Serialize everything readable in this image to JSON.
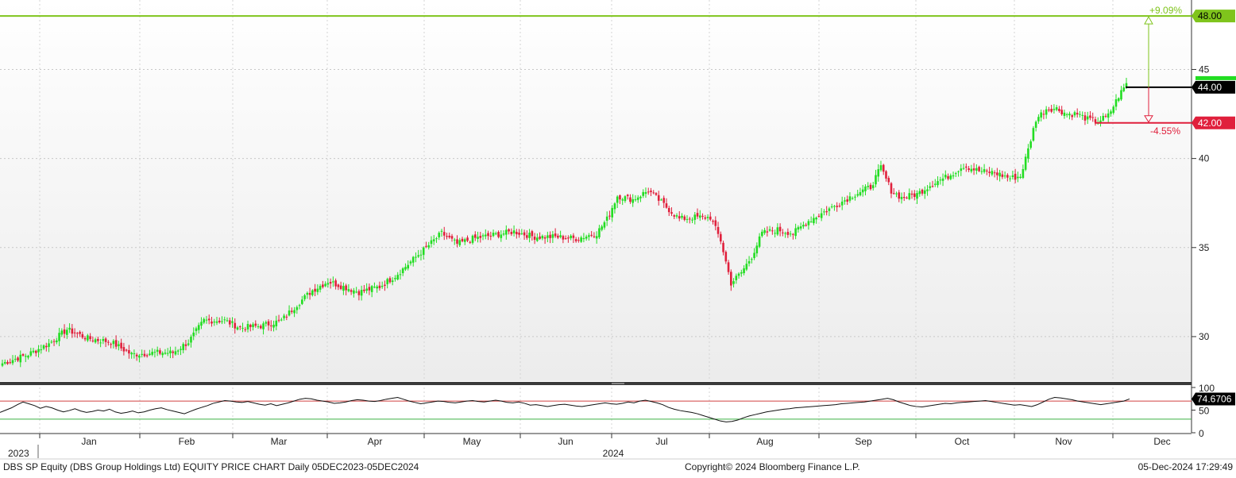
{
  "footer": {
    "title": "DBS SP Equity (DBS Group Holdings Ltd) EQUITY PRICE CHART  Daily 05DEC2023-05DEC2024",
    "copyright": "Copyright© 2024 Bloomberg Finance L.P.",
    "timestamp": "05-Dec-2024 17:29:49"
  },
  "colors": {
    "up": "#22dd22",
    "down": "#e0203c",
    "target": "#7fc41c",
    "stop": "#e0203c",
    "current": "#000000",
    "oscillator_upper": "#d04040",
    "oscillator_lower": "#3cb043"
  },
  "chart_data": [
    {
      "type": "candlestick",
      "name": "price",
      "ylim": [
        27.5,
        48.9
      ],
      "y_ticks": [
        30,
        35,
        40,
        45
      ],
      "y_tick_labels": [
        "30",
        "35",
        "40",
        "45"
      ],
      "grid": true,
      "x_year_labels": [
        "2023",
        "2024"
      ],
      "x_month_labels": [
        "Jan",
        "Feb",
        "Mar",
        "Apr",
        "May",
        "Jun",
        "Jul",
        "Aug",
        "Sep",
        "Oct",
        "Nov",
        "Dec"
      ],
      "anchors": [
        [
          0,
          28.5
        ],
        [
          10,
          29.0
        ],
        [
          18,
          29.6
        ],
        [
          25,
          30.4
        ],
        [
          33,
          29.9
        ],
        [
          42,
          29.7
        ],
        [
          50,
          29.0
        ],
        [
          60,
          29.1
        ],
        [
          66,
          29.1
        ],
        [
          72,
          29.7
        ],
        [
          78,
          30.9
        ],
        [
          86,
          30.9
        ],
        [
          92,
          30.5
        ],
        [
          100,
          30.6
        ],
        [
          108,
          30.9
        ],
        [
          114,
          31.8
        ],
        [
          120,
          32.6
        ],
        [
          126,
          33.1
        ],
        [
          132,
          32.8
        ],
        [
          138,
          32.5
        ],
        [
          146,
          32.8
        ],
        [
          152,
          33.4
        ],
        [
          158,
          34.2
        ],
        [
          164,
          35.0
        ],
        [
          170,
          35.8
        ],
        [
          176,
          35.2
        ],
        [
          182,
          35.5
        ],
        [
          190,
          35.7
        ],
        [
          198,
          35.9
        ],
        [
          206,
          35.6
        ],
        [
          214,
          35.6
        ],
        [
          222,
          35.5
        ],
        [
          230,
          35.8
        ],
        [
          234,
          36.6
        ],
        [
          238,
          37.9
        ],
        [
          244,
          37.7
        ],
        [
          250,
          38.2
        ],
        [
          256,
          37.4
        ],
        [
          262,
          36.6
        ],
        [
          268,
          36.7
        ],
        [
          274,
          36.7
        ],
        [
          278,
          35.4
        ],
        [
          282,
          33.0
        ],
        [
          286,
          33.6
        ],
        [
          290,
          34.5
        ],
        [
          294,
          35.8
        ],
        [
          300,
          36.0
        ],
        [
          306,
          35.8
        ],
        [
          312,
          36.5
        ],
        [
          318,
          37.0
        ],
        [
          324,
          37.5
        ],
        [
          330,
          38.0
        ],
        [
          336,
          38.4
        ],
        [
          340,
          39.5
        ],
        [
          344,
          38.2
        ],
        [
          348,
          37.8
        ],
        [
          354,
          38.0
        ],
        [
          360,
          38.6
        ],
        [
          366,
          39.0
        ],
        [
          372,
          39.6
        ],
        [
          378,
          39.3
        ],
        [
          384,
          39.2
        ],
        [
          390,
          38.9
        ],
        [
          394,
          39.0
        ],
        [
          397,
          40.5
        ],
        [
          400,
          42.2
        ],
        [
          404,
          42.8
        ],
        [
          408,
          42.8
        ],
        [
          412,
          42.5
        ],
        [
          416,
          42.5
        ],
        [
          420,
          42.2
        ],
        [
          424,
          42.1
        ],
        [
          428,
          42.4
        ],
        [
          432,
          43.5
        ],
        [
          435,
          44.2
        ]
      ],
      "levels": [
        {
          "label": "48.00",
          "value": 48.0,
          "pct_label": "+9.09%"
        },
        {
          "label": "44.00",
          "value": 44.0
        },
        {
          "label": "42.00",
          "value": 42.0,
          "pct_label": "-4.55%"
        }
      ]
    },
    {
      "type": "line",
      "name": "oscillator",
      "ylim": [
        0,
        100
      ],
      "y_tick_labels": [
        "100",
        "50",
        "0"
      ],
      "y_ticks": [
        100,
        50,
        0
      ],
      "upper_band": 70,
      "lower_band": 30,
      "last_value_label": "74.6706",
      "values": [
        45,
        50,
        55,
        62,
        68,
        64,
        60,
        54,
        58,
        55,
        50,
        46,
        49,
        53,
        48,
        45,
        47,
        50,
        48,
        52,
        46,
        43,
        45,
        48,
        44,
        46,
        50,
        53,
        55,
        51,
        48,
        45,
        42,
        47,
        52,
        56,
        60,
        65,
        68,
        71,
        70,
        68,
        67,
        69,
        66,
        63,
        61,
        64,
        60,
        63,
        66,
        70,
        74,
        76,
        75,
        72,
        70,
        68,
        65,
        66,
        68,
        71,
        73,
        72,
        70,
        69,
        71,
        74,
        76,
        78,
        74,
        70,
        67,
        64,
        66,
        68,
        70,
        69,
        67,
        66,
        68,
        70,
        71,
        69,
        68,
        70,
        72,
        70,
        67,
        66,
        68,
        65,
        61,
        62,
        60,
        58,
        60,
        62,
        63,
        61,
        59,
        58,
        60,
        62,
        64,
        66,
        64,
        63,
        65,
        68,
        66,
        70,
        72,
        69,
        66,
        62,
        56,
        52,
        49,
        47,
        45,
        42,
        38,
        34,
        30,
        26,
        24,
        25,
        28,
        33,
        37,
        40,
        43,
        46,
        48,
        50,
        52,
        53,
        55,
        56,
        57,
        58,
        59,
        60,
        61,
        62,
        64,
        65,
        66,
        67,
        68,
        70,
        72,
        74,
        76,
        73,
        68,
        64,
        60,
        58,
        57,
        59,
        61,
        63,
        65,
        64,
        66,
        67,
        68,
        69,
        70,
        71,
        69,
        67,
        65,
        63,
        61,
        62,
        60,
        58,
        62,
        68,
        74,
        78,
        77,
        75,
        73,
        70,
        68,
        66,
        64,
        62,
        64,
        66,
        68,
        70,
        74.67
      ]
    }
  ]
}
